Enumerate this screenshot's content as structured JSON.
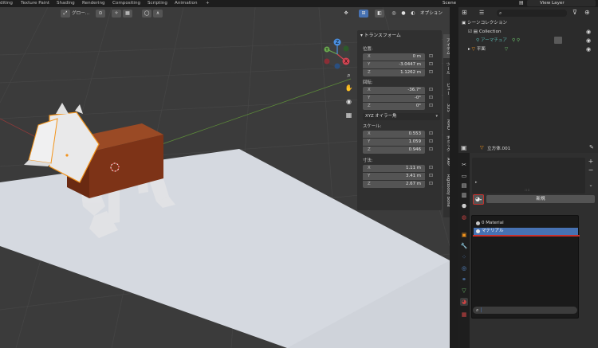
{
  "tabs": [
    "diting",
    "Texture Paint",
    "Shading",
    "Rendering",
    "Compositing",
    "Scripting",
    "Animation",
    "+"
  ],
  "scene": {
    "label": "Scene"
  },
  "view_layer": {
    "label": "View Layer"
  },
  "viewport_header": {
    "transform_orientation": "グロー...",
    "options": "オプション"
  },
  "transform_panel": {
    "title": "トランスフォーム",
    "location_label": "位置:",
    "location": [
      {
        "axis": "X",
        "value": "0 m"
      },
      {
        "axis": "Y",
        "value": "-3.0447 m"
      },
      {
        "axis": "Z",
        "value": "1.1262 m"
      }
    ],
    "rotation_label": "回転:",
    "rotation": [
      {
        "axis": "X",
        "value": "-36.7°"
      },
      {
        "axis": "Y",
        "value": "-0°"
      },
      {
        "axis": "Z",
        "value": "0°"
      }
    ],
    "rotation_mode": "XYZ オイラー角",
    "scale_label": "スケール:",
    "scale": [
      {
        "axis": "X",
        "value": "0.553"
      },
      {
        "axis": "Y",
        "value": "1.059"
      },
      {
        "axis": "Z",
        "value": "0.946"
      }
    ],
    "dimensions_label": "寸法:",
    "dimensions": [
      {
        "axis": "X",
        "value": "1.11 m"
      },
      {
        "axis": "Y",
        "value": "3.41 m"
      },
      {
        "axis": "Z",
        "value": "2.67 m"
      }
    ]
  },
  "sidebar_tabs": [
    "アイテム",
    "ツール",
    "ビュー",
    "3DS",
    "MMD",
    "ギミック",
    "ARP",
    "Rigidbody Bone"
  ],
  "gizmo": {
    "x": "X",
    "y": "Y",
    "z": "Z"
  },
  "outliner": {
    "scene_collection": "シーンコレクション",
    "collection": "Collection",
    "armature": "アーマチュア",
    "plane": "平面"
  },
  "properties": {
    "object_name": "立方体.001",
    "new_button": "新規",
    "materials": [
      {
        "name": "0 Material",
        "selected": false
      },
      {
        "name": "マテリアル",
        "selected": true
      }
    ]
  },
  "colors": {
    "accent_selected": "#4772b3",
    "highlight_red": "#c9302c",
    "horse_body": "#7d3317",
    "outline_orange": "#f2941d"
  }
}
